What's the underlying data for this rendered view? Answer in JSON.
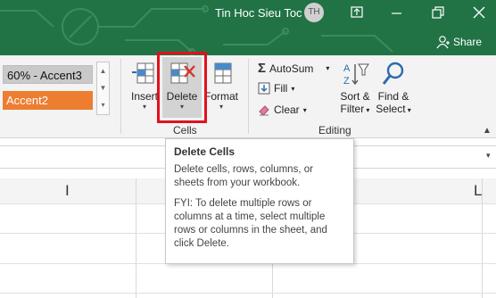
{
  "titlebar": {
    "title": "Tin Hoc Sieu Toc",
    "user_initials": "TH",
    "share_label": "Share",
    "bg_color": "#217346"
  },
  "styles_gallery": {
    "items": [
      {
        "label": "60% - Accent3",
        "color": "#c9c9c9"
      },
      {
        "label": "Accent2",
        "color": "#ed7d31"
      }
    ]
  },
  "cells_group": {
    "label": "Cells",
    "insert_label": "Insert",
    "delete_label": "Delete",
    "format_label": "Format"
  },
  "editing_group": {
    "label": "Editing",
    "autosum_label": "AutoSum",
    "fill_label": "Fill",
    "clear_label": "Clear",
    "sort_filter_line1": "Sort &",
    "sort_filter_line2": "Filter",
    "find_select_line1": "Find &",
    "find_select_line2": "Select"
  },
  "grid": {
    "col_letters": [
      "I",
      "L"
    ]
  },
  "tooltip": {
    "title": "Delete Cells",
    "body1": "Delete cells, rows, columns, or sheets from your workbook.",
    "body2": "FYI: To delete multiple rows or columns at a time, select multiple rows or columns in the sheet, and click Delete."
  },
  "icons": [
    "circuit-decoration",
    "ribbon-display-options-icon",
    "minimize-icon",
    "restore-icon",
    "close-icon",
    "share-person-icon",
    "insert-cells-icon",
    "delete-cells-icon",
    "format-cells-icon",
    "autosum-icon",
    "fill-icon",
    "clear-eraser-icon",
    "sort-filter-icon",
    "find-magnifier-icon"
  ],
  "highlight_color": "#e0121d"
}
